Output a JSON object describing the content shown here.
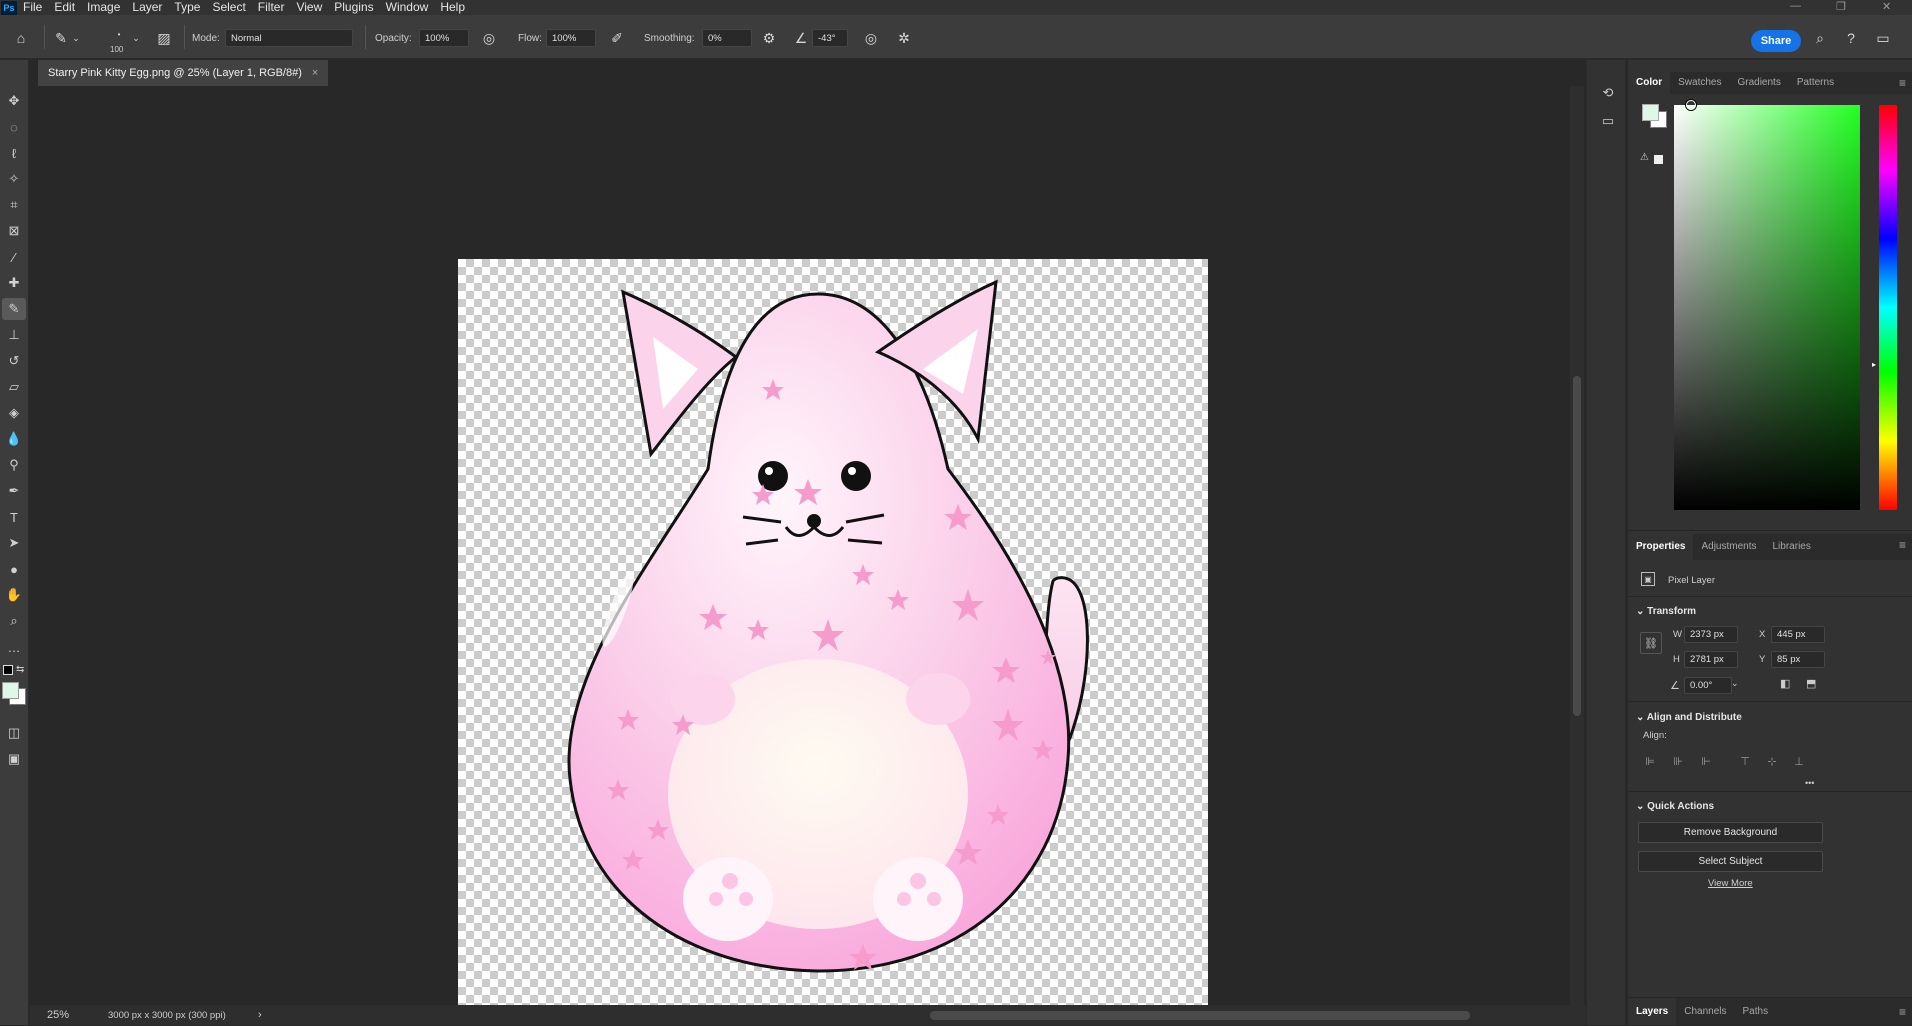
{
  "app": {
    "logo": "Ps"
  },
  "menu": [
    "File",
    "Edit",
    "Image",
    "Layer",
    "Type",
    "Select",
    "Filter",
    "View",
    "Plugins",
    "Window",
    "Help"
  ],
  "window_controls": {
    "minimize": "—",
    "restore": "❐",
    "close": "✕"
  },
  "options": {
    "brush_size": "100",
    "mode_label": "Mode:",
    "mode_value": "Normal",
    "opacity_label": "Opacity:",
    "opacity_value": "100%",
    "flow_label": "Flow:",
    "flow_value": "100%",
    "smoothing_label": "Smoothing:",
    "smoothing_value": "0%",
    "angle_value": "-43°",
    "share_label": "Share"
  },
  "document_tab": {
    "title": "Starry Pink Kitty Egg.png @ 25% (Layer 1, RGB/8#)",
    "close": "×"
  },
  "status": {
    "zoom": "25%",
    "doc_info": "3000 px x 3000 px (300 ppi)",
    "arrow": "›"
  },
  "color_panel": {
    "tabs": [
      "Color",
      "Swatches",
      "Gradients",
      "Patterns"
    ],
    "foreground": "#dff7e8",
    "background": "#ffffff",
    "hue": "#22ff22"
  },
  "properties_panel": {
    "tabs": [
      "Properties",
      "Adjustments",
      "Libraries"
    ],
    "layer_type": "Pixel Layer",
    "transform_title": "Transform",
    "w_label": "W",
    "w_value": "2373 px",
    "h_label": "H",
    "h_value": "2781 px",
    "x_label": "X",
    "x_value": "445 px",
    "y_label": "Y",
    "y_value": "85 px",
    "angle_value": "0.00°",
    "align_title": "Align and Distribute",
    "align_label": "Align:",
    "more": "•••",
    "quick_title": "Quick Actions",
    "remove_bg": "Remove Background",
    "select_subject": "Select Subject",
    "view_more": "View More"
  },
  "layers_panel": {
    "tabs": [
      "Layers",
      "Channels",
      "Paths"
    ]
  }
}
